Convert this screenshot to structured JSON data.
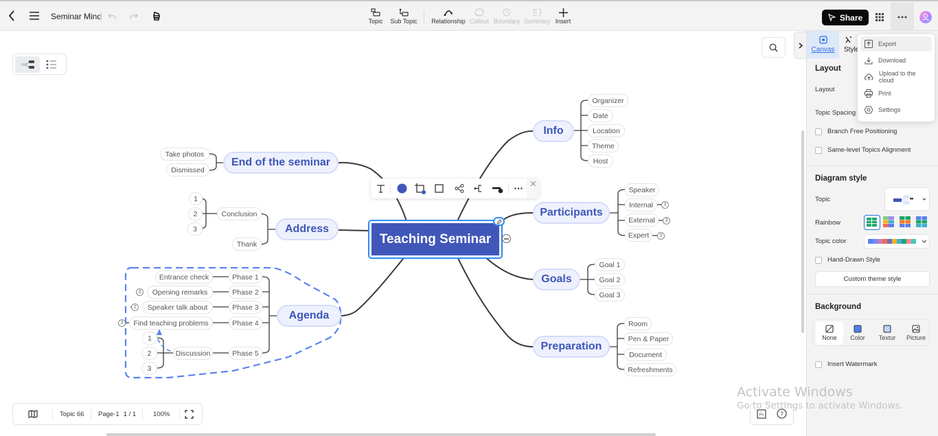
{
  "header": {
    "title": "Seminar Mind",
    "tools": [
      {
        "label": "Topic",
        "icon": "topic-icon",
        "enabled": true
      },
      {
        "label": "Sub Topic",
        "icon": "subtopic-icon",
        "enabled": true
      },
      {
        "label": "Relationship",
        "icon": "relationship-icon",
        "enabled": true
      },
      {
        "label": "Callout",
        "icon": "callout-icon",
        "enabled": false
      },
      {
        "label": "Boundary",
        "icon": "boundary-icon",
        "enabled": false
      },
      {
        "label": "Summary",
        "icon": "summary-icon",
        "enabled": false
      },
      {
        "label": "Insert",
        "icon": "plus-icon",
        "enabled": true
      }
    ],
    "share_label": "Share"
  },
  "mindmap": {
    "root": "Teaching Seminar",
    "branches": {
      "end": {
        "label": "End of the seminar",
        "children": [
          "Take photos",
          "Dismissed"
        ]
      },
      "address": {
        "label": "Address",
        "children": [
          "Conclusion",
          "Thank"
        ],
        "conclusion_children": [
          "1",
          "2",
          "3"
        ]
      },
      "agenda": {
        "label": "Agenda",
        "phases": [
          "Phase 1",
          "Phase 2",
          "Phase 3",
          "Phase 4",
          "Phase 5"
        ],
        "phase_children": [
          "Entrance check",
          "Opening remarks",
          "Speaker talk about",
          "Find teaching problems",
          "Discussion"
        ],
        "phase_badges": [
          "",
          "3",
          "2",
          "3",
          ""
        ],
        "discussion_children": [
          "1",
          "2",
          "3"
        ]
      },
      "info": {
        "label": "Info",
        "children": [
          "Organizer",
          "Date",
          "Location",
          "Theme",
          "Host"
        ]
      },
      "participants": {
        "label": "Participants",
        "children": [
          "Speaker",
          "Internal",
          "External",
          "Expert"
        ],
        "badges": [
          "",
          "3",
          "3",
          "3"
        ]
      },
      "goals": {
        "label": "Goals",
        "children": [
          "Goal 1",
          "Goal 2",
          "Goal 3"
        ]
      },
      "preparation": {
        "label": "Preparation",
        "children": [
          "Room",
          "Pen & Paper",
          "Document",
          "Refreshments"
        ]
      }
    }
  },
  "floating_toolbar": {
    "fill_color": "#4057b9",
    "items": [
      "text-icon",
      "fill-color-icon",
      "border-icon",
      "shape-icon",
      "layout-icon",
      "branch-icon",
      "line-style-icon",
      "more-icon",
      "close-icon"
    ]
  },
  "bottom_bar": {
    "topic_count": "Topic 66",
    "page": "Page-1",
    "page_count": "1 / 1",
    "zoom": "100%"
  },
  "panel": {
    "tabs": [
      {
        "label": "Canvas",
        "active": true
      },
      {
        "label": "Style",
        "active": false
      }
    ],
    "layout_title": "Layout",
    "layout_label": "Layout",
    "topic_spacing_label": "Topic Spacing",
    "branch_free_label": "Branch Free Positioning",
    "same_level_label": "Same-level Topics Alignment",
    "diagram_style_title": "Diagram style",
    "topic_label": "Topic",
    "rainbow_label": "Rainbow",
    "topic_color_label": "Topic color",
    "topic_colors": [
      "#5b7ff0",
      "#6c8ef5",
      "#c97bb5",
      "#ef6a5a",
      "#6a6fbf",
      "#f4b21e",
      "#3fb0d6",
      "#1aa66a",
      "#f28a99",
      "#4cc9b4"
    ],
    "hand_drawn_label": "Hand-Drawn Style",
    "custom_theme_label": "Custom theme style",
    "background_title": "Background",
    "background_options": [
      "None",
      "Color",
      "Textur",
      "Picture"
    ],
    "watermark_label": "Insert Watermark"
  },
  "more_menu": {
    "items": [
      {
        "label": "Export",
        "icon": "export-icon"
      },
      {
        "label": "Download",
        "icon": "download-icon"
      },
      {
        "label": "Upload to the cloud",
        "icon": "cloud-upload-icon"
      },
      {
        "label": "Print",
        "icon": "print-icon"
      },
      {
        "label": "Settings",
        "icon": "settings-icon"
      }
    ]
  },
  "os_watermark": {
    "line1": "Activate Windows",
    "line2": "Go to Settings to activate Windows."
  }
}
